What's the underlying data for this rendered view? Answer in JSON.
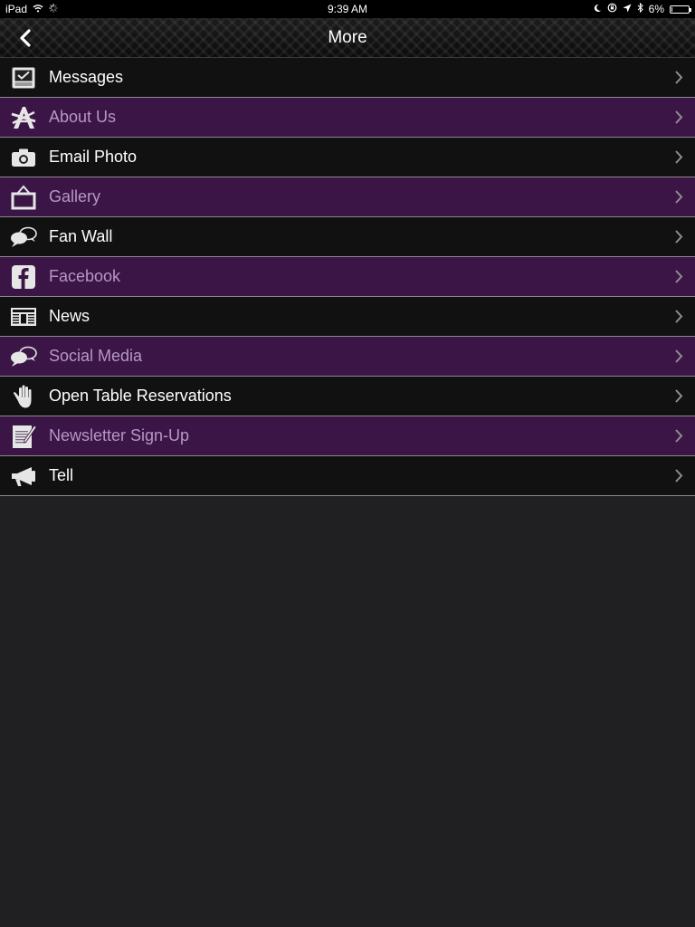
{
  "status": {
    "device": "iPad",
    "time": "9:39 AM",
    "battery": "6%",
    "battery_level": 0.06
  },
  "nav": {
    "title": "More",
    "back_icon": "chevron-left-icon"
  },
  "colors": {
    "row_dark": "#121112",
    "row_purple": "#3c1547",
    "purple_text": "#b597c4",
    "background": "#201f21"
  },
  "menu": [
    {
      "label": "Messages",
      "icon": "inbox-icon",
      "style": "dark"
    },
    {
      "label": "About Us",
      "icon": "about-icon",
      "style": "purple"
    },
    {
      "label": "Email Photo",
      "icon": "camera-icon",
      "style": "dark"
    },
    {
      "label": "Gallery",
      "icon": "gallery-icon",
      "style": "purple"
    },
    {
      "label": "Fan Wall",
      "icon": "chat-bubbles-icon",
      "style": "dark"
    },
    {
      "label": "Facebook",
      "icon": "facebook-icon",
      "style": "purple"
    },
    {
      "label": "News",
      "icon": "newspaper-icon",
      "style": "dark"
    },
    {
      "label": "Social Media",
      "icon": "chat-bubbles-icon",
      "style": "purple"
    },
    {
      "label": "Open Table Reservations",
      "icon": "hand-icon",
      "style": "dark"
    },
    {
      "label": "Newsletter Sign-Up",
      "icon": "note-pencil-icon",
      "style": "purple"
    },
    {
      "label": "Tell",
      "icon": "megaphone-icon",
      "style": "dark"
    }
  ]
}
